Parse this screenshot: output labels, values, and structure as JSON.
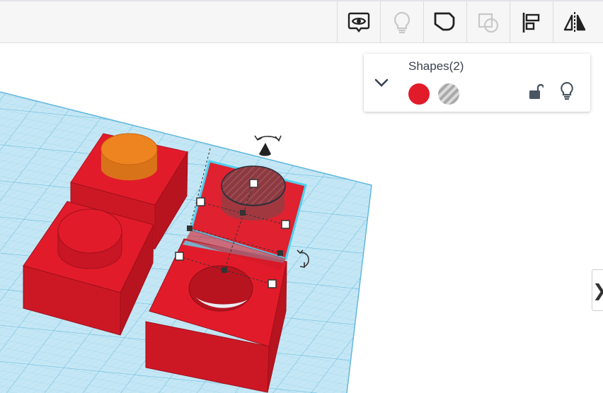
{
  "toolbar": {
    "buttons": [
      {
        "name": "show-all-icon",
        "enabled": true
      },
      {
        "name": "lightbulb-icon",
        "enabled": false
      },
      {
        "name": "group-icon",
        "enabled": true
      },
      {
        "name": "ungroup-icon",
        "enabled": false
      },
      {
        "name": "align-icon",
        "enabled": true
      },
      {
        "name": "mirror-icon",
        "enabled": true
      }
    ]
  },
  "shapes_panel": {
    "title": "Shapes(2)",
    "solid_color": "#e21b2b",
    "hole_label": "hole-pattern",
    "lock_state": "unlocked",
    "visibility_icon": "lightbulb-icon"
  },
  "side_tab": {
    "label": "❯"
  },
  "colors": {
    "workplane": "#bfe4f3",
    "grid": "#7fc6e4",
    "shape_red": "#e21b2b",
    "cylinder_orange": "#ee8420"
  }
}
